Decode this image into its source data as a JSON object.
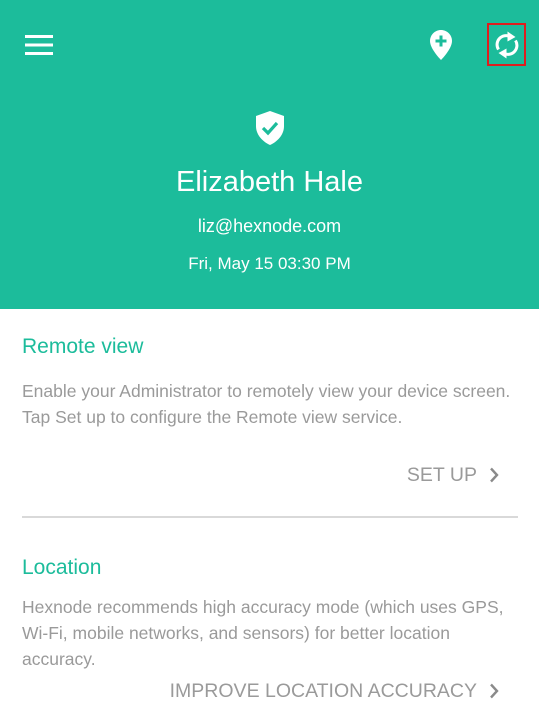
{
  "header": {
    "user_name": "Elizabeth Hale",
    "email": "liz@hexnode.com",
    "datetime": "Fri, May 15 03:30 PM",
    "icons": {
      "menu": "hamburger-menu-icon",
      "location": "location-pin-plus-icon",
      "sync": "sync-icon",
      "status": "shield-check-icon"
    },
    "colors": {
      "background": "#1cbc9b",
      "highlight_border": "#e01e1e"
    }
  },
  "remote_view": {
    "title": "Remote view",
    "description": "Enable your Administrator to remotely view your device screen. Tap Set up to configure the Remote view service.",
    "action_label": "SET UP"
  },
  "location": {
    "title": "Location",
    "description": "Hexnode recommends high accuracy mode (which uses GPS, Wi-Fi, mobile networks, and sensors) for better location accuracy.",
    "action_label": "IMPROVE LOCATION ACCURACY"
  }
}
